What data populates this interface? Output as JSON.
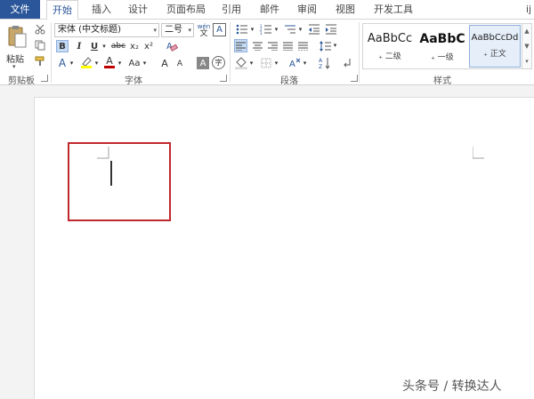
{
  "tabs": {
    "file": "文件",
    "items": [
      "开始",
      "插入",
      "设计",
      "页面布局",
      "引用",
      "邮件",
      "审阅",
      "视图",
      "开发工具"
    ],
    "overflow": "ij"
  },
  "clipboard": {
    "paste_label": "粘贴",
    "group_label": "剪贴板"
  },
  "font": {
    "font_name": "宋体 (中文标题)",
    "font_size": "二号",
    "phonetic_label": "wén",
    "phonetic_char": "文",
    "char_border": "A",
    "bold": "B",
    "italic": "I",
    "underline": "U",
    "strike": "abc",
    "subscript": "x₂",
    "superscript": "x²",
    "text_effect": "A",
    "font_color": "A",
    "change_case": "Aa",
    "grow": "A",
    "shrink": "A",
    "char_shading": "A",
    "enclose": "字",
    "group_label": "字体"
  },
  "paragraph": {
    "group_label": "段落"
  },
  "styles": {
    "items": [
      {
        "sample": "AaBbCc",
        "name": "₊ 二级"
      },
      {
        "sample": "AaBbC",
        "name": "₊ 一级"
      },
      {
        "sample": "AaBbCcDd",
        "name": "₊ 正文"
      }
    ],
    "group_label": "样式"
  },
  "watermark": "头条号 / 转换达人",
  "colors": {
    "accent": "#2b579a",
    "highlight_border": "#c0282e",
    "highlighter": "#ffff00",
    "font_color": "#c00000"
  }
}
